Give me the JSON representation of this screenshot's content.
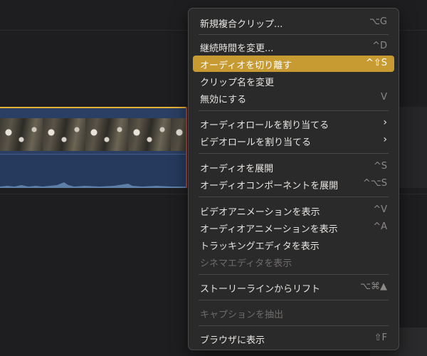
{
  "menu": {
    "items": [
      {
        "label": "新規複合クリップ...",
        "shortcut": "⌥G"
      },
      {
        "label": "継続時間を変更...",
        "shortcut": "^D"
      },
      {
        "label": "オーディオを切り離す",
        "shortcut": "^⇧S"
      },
      {
        "label": "クリップ名を変更",
        "shortcut": ""
      },
      {
        "label": "無効にする",
        "shortcut": "V"
      },
      {
        "label": "オーディオロールを割り当てる",
        "shortcut": "›"
      },
      {
        "label": "ビデオロールを割り当てる",
        "shortcut": "›"
      },
      {
        "label": "オーディオを展開",
        "shortcut": "^S"
      },
      {
        "label": "オーディオコンポーネントを展開",
        "shortcut": "^⌥S"
      },
      {
        "label": "ビデオアニメーションを表示",
        "shortcut": "^V"
      },
      {
        "label": "オーディオアニメーションを表示",
        "shortcut": "^A"
      },
      {
        "label": "トラッキングエディタを表示",
        "shortcut": ""
      },
      {
        "label": "シネマエディタを表示",
        "shortcut": ""
      },
      {
        "label": "ストーリーラインからリフト",
        "shortcut": "⌥⌘▲"
      },
      {
        "label": "キャプションを抽出",
        "shortcut": ""
      },
      {
        "label": "ブラウザに表示",
        "shortcut": "⇧F"
      }
    ]
  },
  "colors": {
    "highlight": "#c89a32",
    "clip_border": "#e7b43a",
    "clip_body": "#2a3f63"
  }
}
